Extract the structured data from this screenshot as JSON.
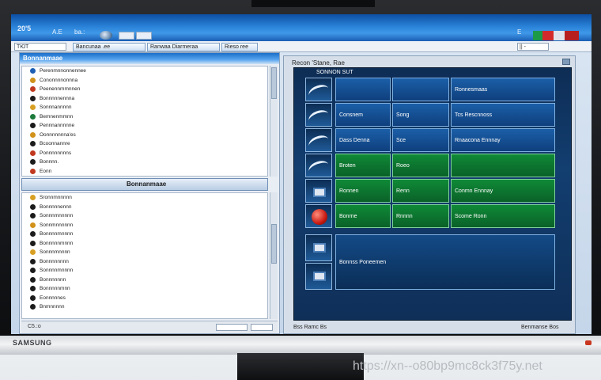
{
  "taskbar": {
    "clock": "20'5",
    "items": [
      "A.E",
      "ba.:"
    ],
    "tray_label": "E"
  },
  "addressbar": {
    "left_field": "ТЮТ",
    "tabs": [
      "Bancunaa .ee",
      "Ranwaa Diarmeraa",
      "Rieso ree"
    ],
    "right_field": "|| -"
  },
  "left_panel": {
    "title": "Bonnanmaae",
    "list_top": [
      {
        "text": "Perenmnnonnennee",
        "color": "#1d5fb3"
      },
      {
        "text": "Cononnnnonnna",
        "color": "#d1921a"
      },
      {
        "text": "Peenennmmnnen",
        "color": "#c0391f"
      },
      {
        "text": "Bonnnnnennna",
        "color": "#1b1b1b"
      },
      {
        "text": "Sonnnannnnn",
        "color": "#d8a023"
      },
      {
        "text": "Bemnenmmnn",
        "color": "#1c7a3a"
      },
      {
        "text": "Pennnannnnne",
        "color": "#1b1b1b"
      },
      {
        "text": "Oonnnnnnna'es",
        "color": "#d1921a"
      },
      {
        "text": "Bcoonnannre",
        "color": "#1b1b1b"
      },
      {
        "text": "Ponnnnnnnns",
        "color": "#c0391f"
      },
      {
        "text": "Bonnnn.",
        "color": "#1b1b1b"
      },
      {
        "text": "Eonn",
        "color": "#c0391f"
      }
    ],
    "divider_label": "Bonnanmaae",
    "list_bottom": [
      {
        "text": "Sronnmnnnnn",
        "color": "#d8a023"
      },
      {
        "text": "Bonnnnnennn",
        "color": "#1b1b1b"
      },
      {
        "text": "Sonnnmnnnnn",
        "color": "#1b1b1b"
      },
      {
        "text": "Sonnmnnnnnn",
        "color": "#d1921a"
      },
      {
        "text": "Bonnnnmnnnn",
        "color": "#1b1b1b"
      },
      {
        "text": "Bonnnnnmnnn",
        "color": "#1b1b1b"
      },
      {
        "text": "Sonnnmnnnn",
        "color": "#d8a023"
      },
      {
        "text": "Bonnnnnnnn",
        "color": "#1b1b1b"
      },
      {
        "text": "Sonnnnmnnnn",
        "color": "#1b1b1b"
      },
      {
        "text": "Bonnnnnnn",
        "color": "#1b1b1b"
      },
      {
        "text": "Bonnnnnmnn",
        "color": "#1b1b1b"
      },
      {
        "text": "Eonnnnnes",
        "color": "#1b1b1b"
      },
      {
        "text": "Bnmnnnnn",
        "color": "#1b1b1b"
      }
    ],
    "status_text": "C5.:o"
  },
  "right_panel": {
    "title": "Recon 'Stane, Rae",
    "dash_header": "SONNON SUT",
    "cells": [
      {
        "c1": "",
        "c2": "",
        "c3": "Ronnesmaas"
      },
      {
        "c1": "Consnem",
        "c2": "Song",
        "c3": "Tcs Rescnnoss"
      },
      {
        "c1": "Dass Denna",
        "c2": "Sce",
        "c3": "Rnaacona Ennnay"
      },
      {
        "c1": "Broten",
        "c2": "Roeo",
        "c3": ""
      },
      {
        "c1": "Ronnen",
        "c2": "Renn",
        "c3": "Conmn Ennnay"
      },
      {
        "c1": "Bonrne",
        "c2": "Rnnnn",
        "c3": "Scome Ronn"
      },
      {
        "c1": "",
        "c2": "",
        "c3": "Bonnss Poneemen"
      }
    ],
    "status_left": "Bss Ramc Bs",
    "status_right": "Benmanse Bos"
  },
  "monitor": {
    "brand": "SAMSUNG"
  },
  "watermark": "https://xn--o80bp9mc8ck3f75y.net",
  "colors": {
    "taskbar": "#2a82d8",
    "dash_blue": "#1b5fa8",
    "dash_green": "#0f8a37",
    "monitor_bezel": "#15171a"
  }
}
